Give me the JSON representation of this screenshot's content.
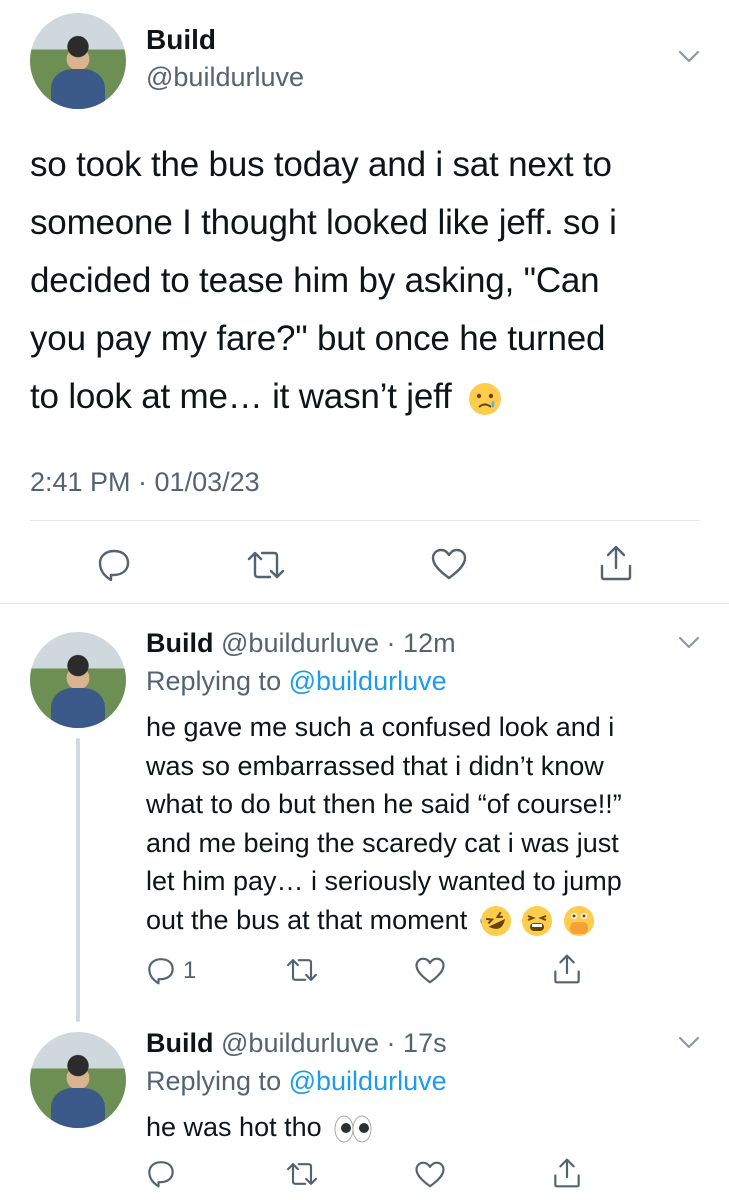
{
  "main_tweet": {
    "name": "Build",
    "handle": "@buildurluve",
    "lines": [
      "so took the bus today and i sat next to",
      "someone I thought looked like jeff. so i",
      "decided to tease him by asking, \"Can",
      "you pay my fare?\" but once he turned",
      "to look at me… it wasn’t jeff"
    ],
    "emoji": "sad-tear-emoji",
    "timestamp": "2:41 PM · 01/03/23"
  },
  "replies": [
    {
      "name": "Build",
      "handle": "@buildurluve",
      "sep": "·",
      "time": "12m",
      "replying_prefix": "Replying to",
      "replying_handle": "@buildurluve",
      "lines": [
        "he gave me such a confused look and i",
        "was so embarrassed that i didn’t know",
        "what to do but then he said “of course!!”",
        "and me being the scaredy cat i was just",
        "let him pay… i seriously wanted to jump",
        "out the bus at that moment"
      ],
      "emojis": [
        "rofl-emoji",
        "tired-face-emoji",
        "face-with-hand-over-mouth-emoji"
      ],
      "reply_count": "1"
    },
    {
      "name": "Build",
      "handle": "@buildurluve",
      "sep": "·",
      "time": "17s",
      "replying_prefix": "Replying to",
      "replying_handle": "@buildurluve",
      "lines": [
        "he was hot tho"
      ],
      "emojis": [
        "eyes-emoji"
      ],
      "reply_count": ""
    }
  ],
  "colors": {
    "text": "#0f1419",
    "secondary": "#536471",
    "link": "#1d9bf0",
    "divider": "#e6e6e6",
    "thread_line": "#cfd9de"
  }
}
